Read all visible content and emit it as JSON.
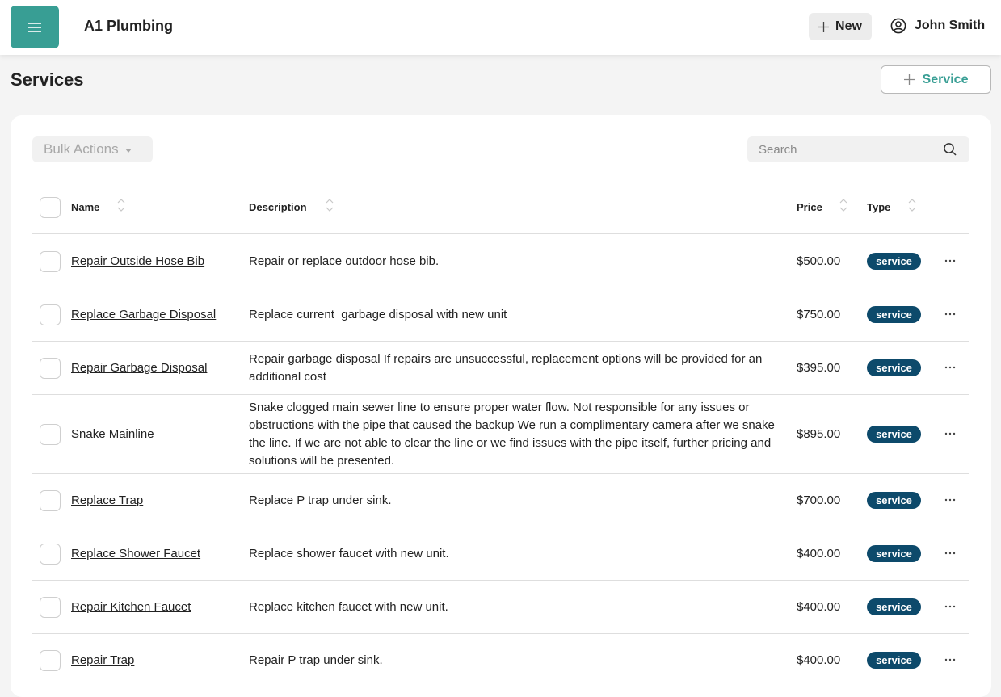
{
  "header": {
    "company_name": "A1 Plumbing",
    "new_label": "New",
    "user_name": "John Smith"
  },
  "page": {
    "title": "Services",
    "add_button_label": "Service"
  },
  "toolbar": {
    "bulk_actions_label": "Bulk Actions",
    "search_placeholder": "Search"
  },
  "table": {
    "columns": {
      "name": "Name",
      "description": "Description",
      "price": "Price",
      "type": "Type"
    },
    "rows": [
      {
        "name": "Repair Outside Hose Bib",
        "description": "Repair or replace outdoor hose bib.",
        "price": "$500.00",
        "type": "service"
      },
      {
        "name": "Replace Garbage Disposal",
        "description": "Replace current  garbage disposal with new unit",
        "price": "$750.00",
        "type": "service"
      },
      {
        "name": "Repair Garbage Disposal",
        "description": "Repair garbage disposal If repairs are unsuccessful, replacement options will be provided for an additional cost",
        "price": "$395.00",
        "type": "service"
      },
      {
        "name": "Snake Mainline",
        "description": "Snake clogged main sewer line to ensure proper water flow. Not responsible for any issues or obstructions with the pipe that caused the backup We run a complimentary camera after we snake the line. If we are not able to clear the line or we find issues with the pipe itself, further pricing and solutions will be presented.",
        "price": "$895.00",
        "type": "service"
      },
      {
        "name": "Replace Trap",
        "description": "Replace P trap under sink.",
        "price": "$700.00",
        "type": "service"
      },
      {
        "name": "Replace Shower Faucet",
        "description": "Replace shower faucet with new unit.",
        "price": "$400.00",
        "type": "service"
      },
      {
        "name": "Repair Kitchen Faucet",
        "description": "Replace kitchen faucet with new unit.",
        "price": "$400.00",
        "type": "service"
      },
      {
        "name": "Repair Trap",
        "description": "Repair P trap under sink.",
        "price": "$400.00",
        "type": "service"
      }
    ]
  },
  "colors": {
    "accent": "#389e94",
    "badge": "#0d4a6b"
  },
  "icons": {
    "menu": "hamburger-menu-icon",
    "new": "plus-icon",
    "user": "user-circle-icon",
    "add_service": "plus-icon",
    "bulk_caret": "caret-down-icon",
    "search": "search-icon",
    "sort": "sort-icon",
    "row_actions": "ellipsis-icon"
  }
}
